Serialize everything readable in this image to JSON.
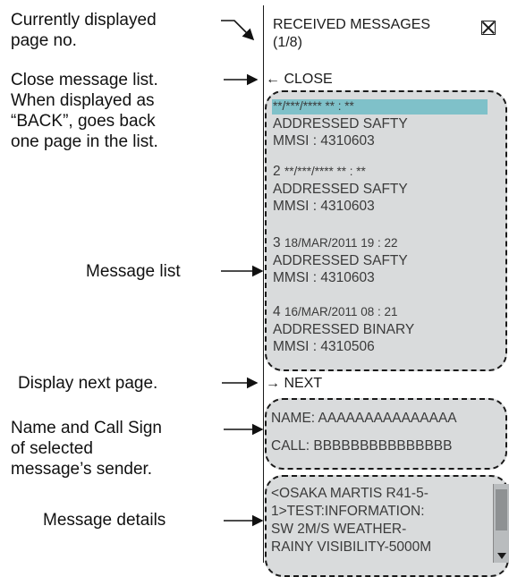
{
  "callouts": {
    "page_no": [
      "Currently displayed",
      "page no."
    ],
    "close_list": [
      "Close message list.",
      "When displayed as",
      "“BACK”, goes back",
      "one page in the list."
    ],
    "message_list": "Message list",
    "next_page": "Display next page.",
    "sender": [
      "Name and Call Sign",
      "of selected",
      "message’s sender."
    ],
    "details": "Message details"
  },
  "panel": {
    "title": "RECEIVED MESSAGES",
    "page_count": "(1/8)",
    "close_label": "← CLOSE",
    "next_label": "→ NEXT"
  },
  "messages": [
    {
      "num": "",
      "datetime": "**/***/****  ** : **",
      "type": "ADDRESSED SAFTY",
      "mmsi": "MMSI : 4310603"
    },
    {
      "num": "2",
      "datetime": "**/***/****  ** : **",
      "type": "ADDRESSED SAFTY",
      "mmsi": "MMSI : 4310603"
    },
    {
      "num": "3",
      "datetime": "18/MAR/2011  19 : 22",
      "type": "ADDRESSED SAFTY",
      "mmsi": "MMSI : 4310603"
    },
    {
      "num": "4",
      "datetime": "16/MAR/2011  08 : 21",
      "type": "ADDRESSED BINARY",
      "mmsi": "MMSI : 4310506"
    }
  ],
  "sender": {
    "name": "NAME: AAAAAAAAAAAAAAA",
    "call": "CALL: BBBBBBBBBBBBBBB"
  },
  "details": [
    "<OSAKA MARTIS R41-5-",
    "1>TEST:INFORMATION:",
    "SW 2M/S WEATHER-",
    "RAINY VISIBILITY-5000M"
  ],
  "colors": {
    "panel_gray": "#d9dbdc",
    "selection": "#7fc1c9",
    "text": "#1a1a1a"
  }
}
